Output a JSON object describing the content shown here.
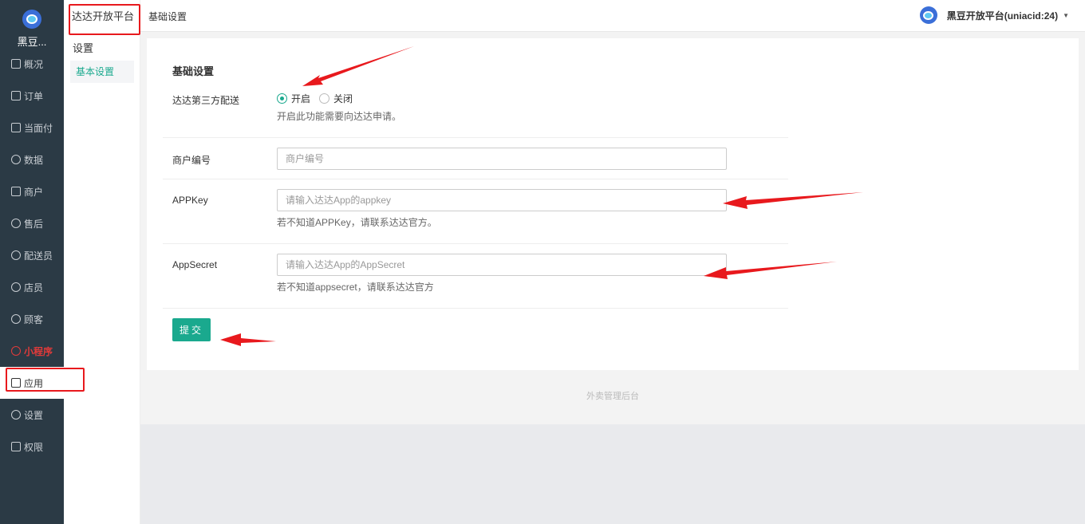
{
  "sidebar": {
    "brand": "黑豆...",
    "items": [
      {
        "label": "概况"
      },
      {
        "label": "订单"
      },
      {
        "label": "当面付"
      },
      {
        "label": "数据"
      },
      {
        "label": "商户"
      },
      {
        "label": "售后"
      },
      {
        "label": "配送员"
      },
      {
        "label": "店员"
      },
      {
        "label": "顾客"
      },
      {
        "label": "小程序"
      },
      {
        "label": "应用"
      },
      {
        "label": "设置"
      },
      {
        "label": "权限"
      }
    ]
  },
  "subnav": {
    "title": "达达开放平台",
    "group": "设置",
    "link": "基本设置"
  },
  "header": {
    "breadcrumb": "基础设置",
    "user": "黑豆开放平台(uniacid:24)"
  },
  "form": {
    "section_title": "基础设置",
    "delivery": {
      "label": "达达第三方配送",
      "options": [
        "开启",
        "关闭"
      ],
      "selected": "开启",
      "help": "开启此功能需要向达达申请。"
    },
    "merchant_no": {
      "label": "商户编号",
      "value": "",
      "placeholder": "商户编号"
    },
    "app_key": {
      "label": "APPKey",
      "value": "",
      "placeholder": "请输入达达App的appkey",
      "help": "若不知道APPKey，请联系达达官方。"
    },
    "app_secret": {
      "label": "AppSecret",
      "value": "",
      "placeholder": "请输入达达App的AppSecret",
      "help": "若不知道appsecret，请联系达达官方"
    },
    "submit_label": "提交"
  },
  "footer": "外卖管理后台",
  "colors": {
    "accent": "#1aa98e",
    "sidebar": "#2b3a45",
    "annotation": "#e8191d",
    "highlight": "#e23a3a"
  }
}
